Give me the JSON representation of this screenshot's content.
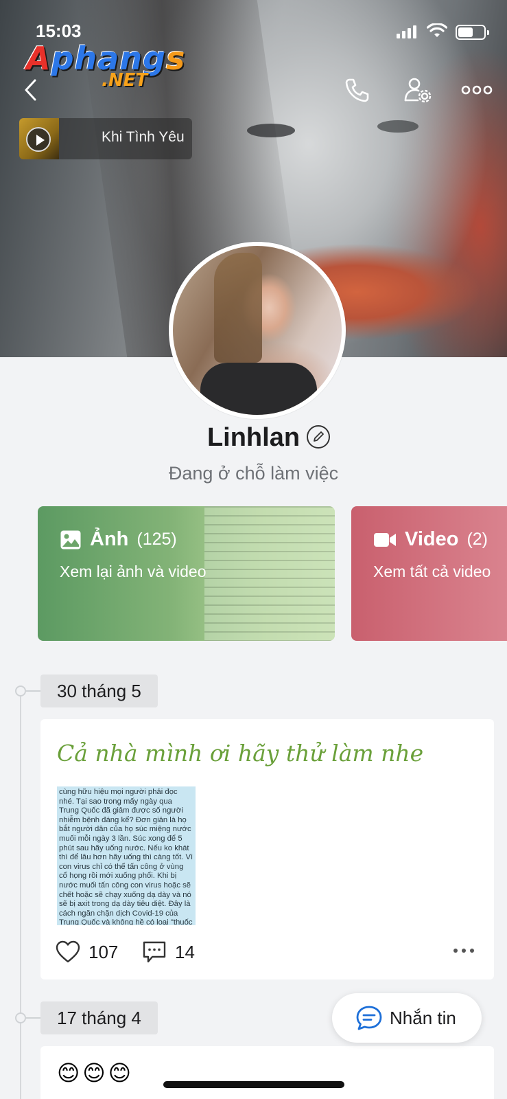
{
  "status_bar": {
    "time": "15:03"
  },
  "watermark": {
    "main": "Aphangs",
    "suffix": ".NET"
  },
  "music": {
    "title": "Khi Tình Yêu"
  },
  "profile": {
    "name": "Linhlan",
    "status": "Đang ở chỗ làm việc"
  },
  "cards": {
    "photos": {
      "title": "Ảnh",
      "count": "(125)",
      "subtitle": "Xem lại ảnh và video"
    },
    "videos": {
      "title": "Video",
      "count": "(2)",
      "subtitle": "Xem tất cả video"
    }
  },
  "timeline": [
    {
      "date": "30 tháng 5",
      "caption": "Cả nhà mình ơi hãy thử làm nhe",
      "image_text": "cùng hữu hiệu mọi người phải đọc nhé. Tại sao trong mấy ngày qua Trung Quốc đã giảm được số người nhiễm bệnh đáng kể? Đơn giản là họ bắt người dân của họ súc miệng nước muối mỗi ngày 3 lần. Súc xong để 5 phút sau hãy uống nước. Nếu ko khát thì để lâu hơn hãy uống thì càng tốt. Vì con virus chỉ có thể tấn công ở vùng cổ họng rồi mới xuống phổi. Khi bị nước muối tấn công con virus hoặc sẽ chết hoặc sẽ chạy xuống dạ dày và nó sẽ bị axit trong dạ dày tiêu diệt. Đây là cách ngăn chặn dịch Covid-19 của Trung Quốc và không hề có loại \"thuốc giải\" nào bán trên thị trường nên đừng có mua bậy bạ nhé. P/",
      "likes": "107",
      "comments": "14"
    },
    {
      "date": "17 tháng 4",
      "emojis": "😊😊😊"
    }
  ],
  "message_button": {
    "label": "Nhắn tin"
  }
}
